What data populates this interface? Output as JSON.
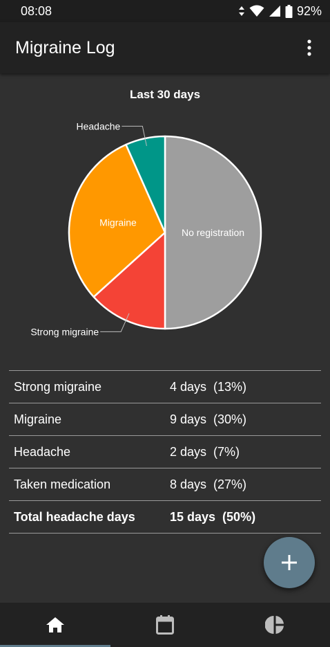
{
  "status_bar": {
    "time": "08:08",
    "battery": "92%"
  },
  "app_bar": {
    "title": "Migraine Log"
  },
  "chart_data": {
    "type": "pie",
    "title": "Last 30 days",
    "slices": [
      {
        "label": "No registration",
        "value": 50,
        "color": "#9e9e9e"
      },
      {
        "label": "Strong migraine",
        "value": 13.33,
        "color": "#f44336"
      },
      {
        "label": "Migraine",
        "value": 30,
        "color": "#ff9800"
      },
      {
        "label": "Headache",
        "value": 6.67,
        "color": "#009688"
      }
    ]
  },
  "stats": [
    {
      "label": "Strong migraine",
      "value": "4 days  (13%)"
    },
    {
      "label": "Migraine",
      "value": "9 days  (30%)"
    },
    {
      "label": "Headache",
      "value": "2 days  (7%)"
    },
    {
      "label": "Taken medication",
      "value": "8 days  (27%)"
    },
    {
      "label": "Total headache days",
      "value": "15 days  (50%)"
    }
  ],
  "fab": {
    "icon": "plus-icon"
  },
  "bottom_nav": [
    {
      "icon": "home-icon",
      "selected": true
    },
    {
      "icon": "calendar-icon",
      "selected": false
    },
    {
      "icon": "pie-chart-icon",
      "selected": false
    }
  ]
}
